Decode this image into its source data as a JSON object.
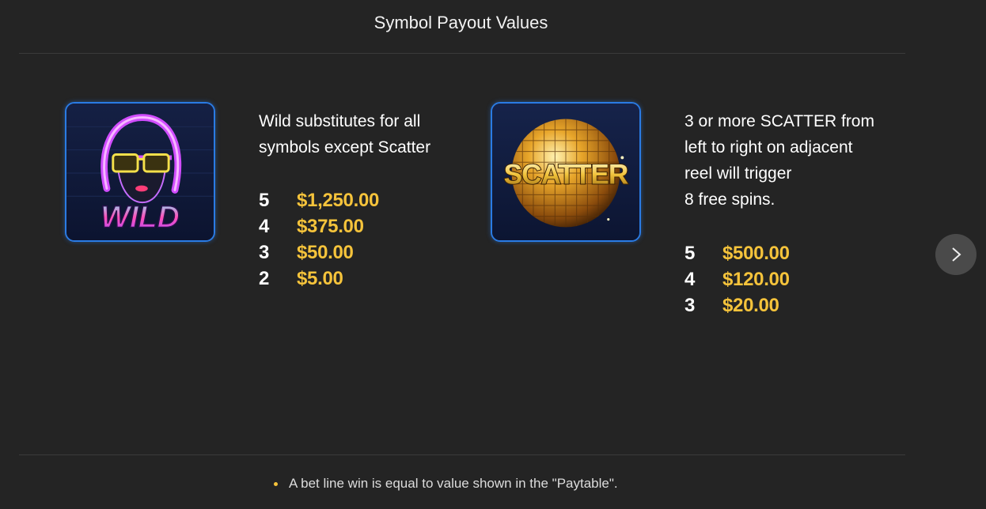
{
  "header": {
    "title": "Symbol Payout Values"
  },
  "symbols": [
    {
      "name": "Wild",
      "tile_text": "WILD",
      "description_lines": [
        "Wild substitutes for all",
        "symbols except Scatter"
      ],
      "payouts": [
        {
          "count": "5",
          "amount": "$1,250.00"
        },
        {
          "count": "4",
          "amount": "$375.00"
        },
        {
          "count": "3",
          "amount": "$50.00"
        },
        {
          "count": "2",
          "amount": "$5.00"
        }
      ]
    },
    {
      "name": "Scatter",
      "tile_text": "SCATTER",
      "description_lines": [
        "3 or more SCATTER from",
        "left to right on adjacent",
        "reel will trigger",
        "8 free spins."
      ],
      "payouts": [
        {
          "count": "5",
          "amount": "$500.00"
        },
        {
          "count": "4",
          "amount": "$120.00"
        },
        {
          "count": "3",
          "amount": "$20.00"
        }
      ]
    }
  ],
  "navigation": {
    "next_icon": "chevron-right-icon"
  },
  "footer": {
    "note": "A bet line win is equal to value shown in the \"Paytable\"."
  },
  "colors": {
    "background": "#242424",
    "amount": "#f5c33b",
    "tile_border": "#2a7be4",
    "bullet": "#f5c33b"
  }
}
